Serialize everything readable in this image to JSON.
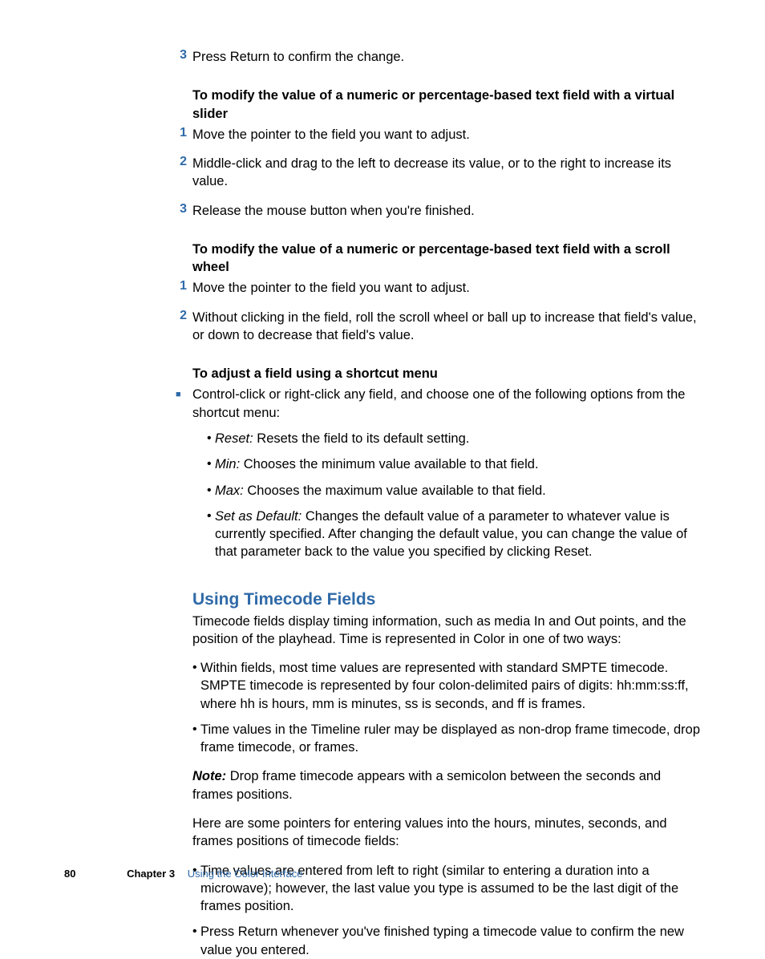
{
  "step3a": "Press Return to confirm the change.",
  "intro1": "To modify the value of a numeric or percentage-based text field with a virtual slider",
  "s1_1": "Move the pointer to the field you want to adjust.",
  "s1_2": "Middle-click and drag to the left to decrease its value, or to the right to increase its value.",
  "s1_3": "Release the mouse button when you're finished.",
  "intro2": "To modify the value of a numeric or percentage-based text field with a scroll wheel",
  "s2_1": "Move the pointer to the field you want to adjust.",
  "s2_2": "Without clicking in the field, roll the scroll wheel or ball up to increase that field's value, or down to decrease that field's value.",
  "intro3": "To adjust a field using a shortcut menu",
  "s3_bullet": "Control-click or right-click any field, and choose one of the following options from the shortcut menu:",
  "opt1_term": "Reset:",
  "opt1_desc": "  Resets the field to its default setting.",
  "opt2_term": "Min:",
  "opt2_desc": "  Chooses the minimum value available to that field.",
  "opt3_term": "Max:",
  "opt3_desc": "  Chooses the maximum value available to that field.",
  "opt4_term": "Set as Default:",
  "opt4_desc": "  Changes the default value of a parameter to whatever value is currently specified. After changing the default value, you can change the value of that parameter back to the value you specified by clicking Reset.",
  "h2": "Using Timecode Fields",
  "p1": "Timecode fields display timing information, such as media In and Out points, and the position of the playhead. Time is represented in Color in one of two ways:",
  "b1": "Within fields, most time values are represented with standard SMPTE timecode. SMPTE timecode is represented by four colon-delimited pairs of digits: hh:mm:ss:ff, where hh is hours, mm is minutes, ss is seconds, and ff is frames.",
  "b2": "Time values in the Timeline ruler may be displayed as non-drop frame timecode, drop frame timecode, or frames.",
  "note_label": "Note:",
  "note_body": "  Drop frame timecode appears with a semicolon between the seconds and frames positions.",
  "p2": "Here are some pointers for entering values into the hours, minutes, seconds, and frames positions of timecode fields:",
  "b3": "Time values are entered from left to right (similar to entering a duration into a microwave); however, the last value you type is assumed to be the last digit of the frames position.",
  "b4": "Press Return whenever you've finished typing a timecode value to confirm the new value you entered.",
  "footer_page": "80",
  "footer_chapter": "Chapter 3",
  "footer_section": "Using the Color Interface"
}
